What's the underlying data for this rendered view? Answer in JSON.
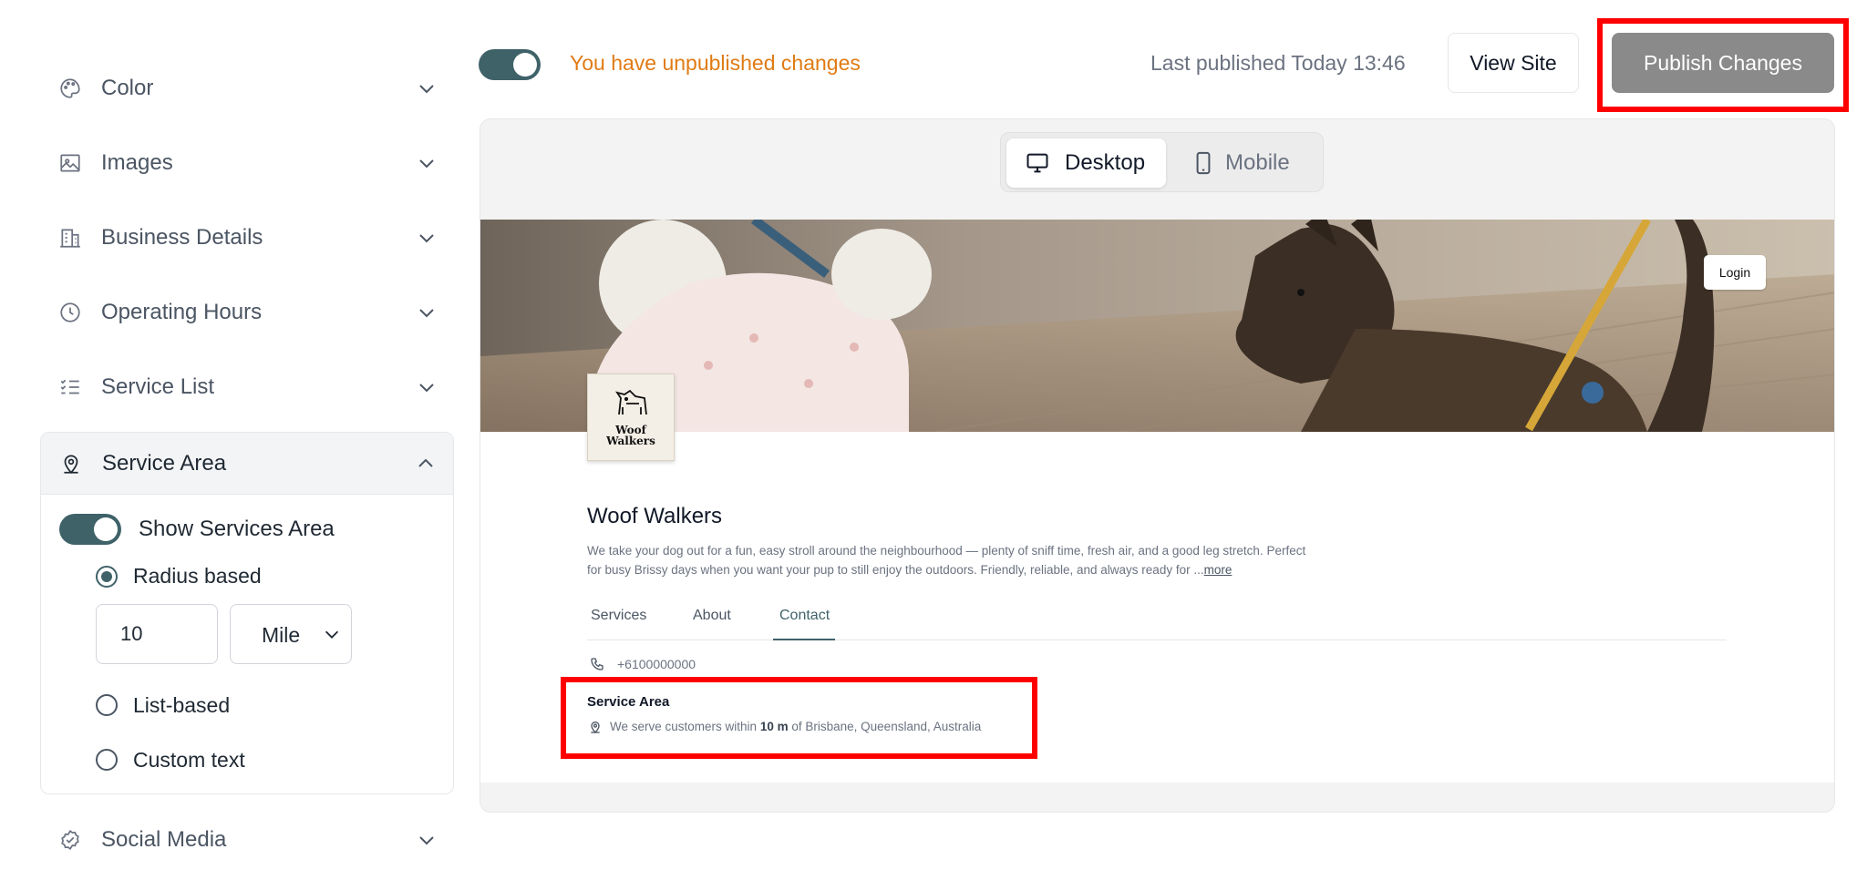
{
  "sidebar": {
    "sections": [
      {
        "label": "Color",
        "icon": "palette-icon"
      },
      {
        "label": "Images",
        "icon": "image-icon"
      },
      {
        "label": "Business Details",
        "icon": "building-icon"
      },
      {
        "label": "Operating Hours",
        "icon": "clock-icon"
      },
      {
        "label": "Service List",
        "icon": "checklist-icon"
      },
      {
        "label": "Service Area",
        "icon": "map-pin-icon"
      },
      {
        "label": "Social Media",
        "icon": "badge-check-icon"
      }
    ],
    "service_area": {
      "show_label": "Show Services Area",
      "show_enabled": true,
      "options": {
        "radius": "Radius based",
        "list": "List-based",
        "custom": "Custom text"
      },
      "selected_option": "radius",
      "radius_value": "10",
      "unit_value": "Mile"
    }
  },
  "topbar": {
    "unpublished_text": "You have unpublished changes",
    "last_published": "Last published Today 13:46",
    "view_site_label": "View Site",
    "publish_label": "Publish Changes"
  },
  "preview": {
    "device_tabs": {
      "desktop": "Desktop",
      "mobile": "Mobile"
    },
    "active_device": "desktop",
    "login_label": "Login",
    "logo_text": [
      "Woof",
      "Walkers"
    ],
    "business_name": "Woof Walkers",
    "description_line1": "We take your dog out for a fun, easy stroll around the neighbourhood — plenty of sniff time, fresh air, and a good leg stretch. Perfect",
    "description_line2": "for busy Brissy days when you want your pup to still enjoy the outdoors. Friendly, reliable, and always ready for ...",
    "more_label": "more",
    "tabs": [
      "Services",
      "About",
      "Contact"
    ],
    "active_tab": "Contact",
    "phone": "+6100000000",
    "service_area_title": "Service Area",
    "service_area_prefix": "We serve customers within",
    "service_area_distance": "10 m",
    "service_area_suffix": "of Brisbane, Queensland, Australia"
  },
  "colors": {
    "accent": "#3f6269",
    "warning": "#e07b14",
    "publish_button": "#8a8a8a",
    "highlight": "#ff0000"
  }
}
